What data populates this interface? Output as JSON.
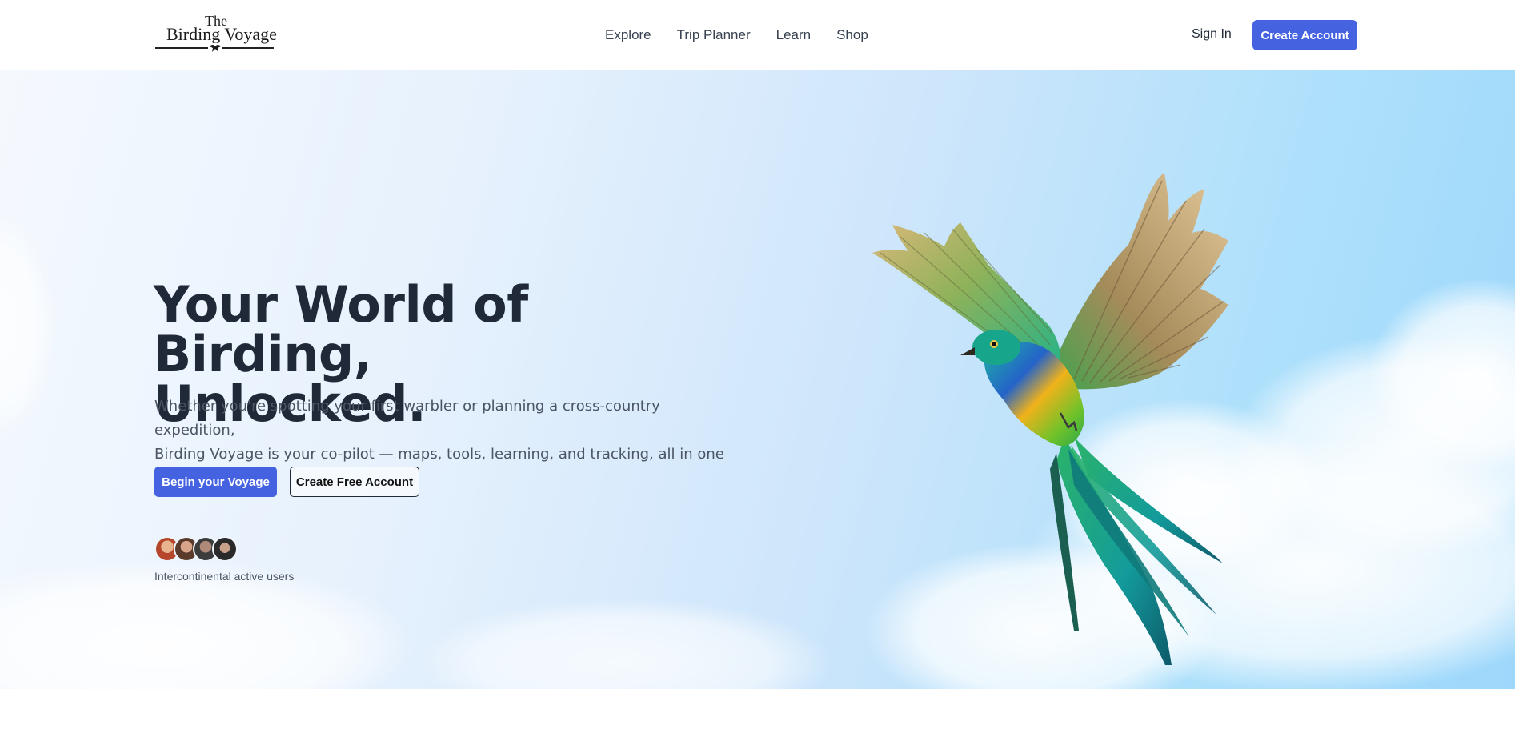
{
  "brand": {
    "top": "The",
    "name": "Birding Voyage"
  },
  "nav": {
    "items": [
      {
        "label": "Explore"
      },
      {
        "label": "Trip Planner"
      },
      {
        "label": "Learn"
      },
      {
        "label": "Shop"
      }
    ]
  },
  "auth": {
    "sign_in": "Sign In",
    "create_account": "Create Account"
  },
  "hero": {
    "headline_line1": "Your World of Birding,",
    "headline_line2": "Unlocked.",
    "sub_line1": "Whether you're spotting your first warbler or planning a cross-country expedition,",
    "sub_line2": "Birding Voyage is your co-pilot — maps, tools, learning, and tracking, all in one nest.",
    "primary_cta": "Begin your Voyage",
    "secondary_cta": "Create Free Account",
    "users_label": "Intercontinental active users"
  },
  "colors": {
    "accent": "#4563e1",
    "text_dark": "#1f2937",
    "sky": "#9dd7fb"
  },
  "icons": [
    "logo-bird-icon",
    "user-avatar",
    "quetzal-bird-illustration"
  ]
}
